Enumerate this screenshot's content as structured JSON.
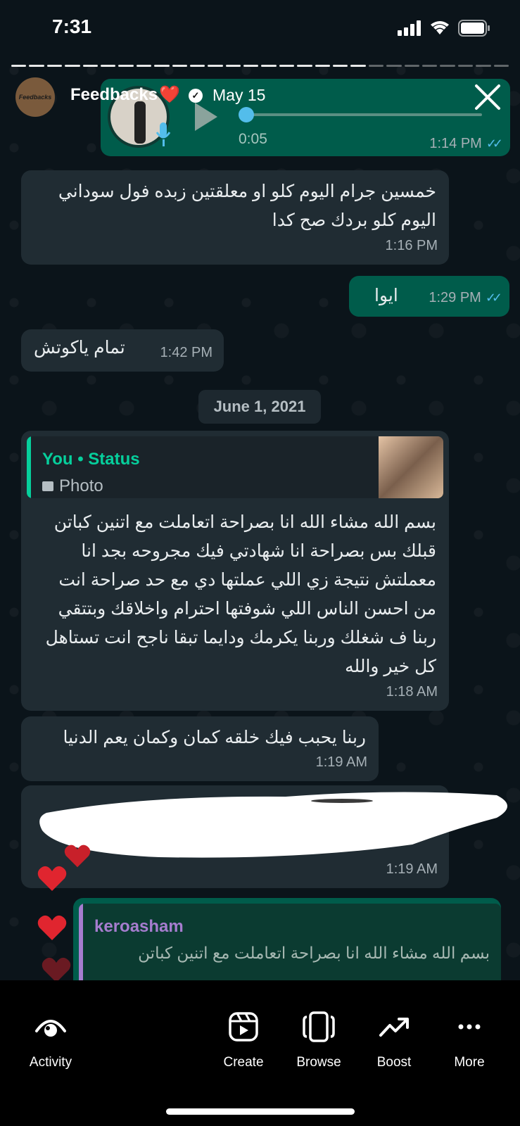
{
  "status_bar": {
    "time": "7:31"
  },
  "story": {
    "username": "Feedbacks",
    "username_emoji": "❤️",
    "avatar_text": "Feedbacks",
    "date": "May 15",
    "close_icon": "close-icon"
  },
  "voice_message": {
    "duration": "0:05",
    "time": "1:14 PM"
  },
  "messages": [
    {
      "dir": "in",
      "text": "خمسين جرام اليوم كلو او معلقتين زبده فول سوداني اليوم كلو بردك صح كدا",
      "time": "1:16 PM"
    },
    {
      "dir": "out",
      "text": "ايوا",
      "time": "1:29 PM"
    },
    {
      "dir": "in",
      "text": "تمام ياكوتش",
      "time": "1:42 PM"
    }
  ],
  "date_separator": "June 1, 2021",
  "status_reply": {
    "quote_title": "You • Status",
    "quote_sub": "Photo",
    "text": "بسم الله مشاء الله انا بصراحة اتعاملت مع اتنين كباتن قبلك بس بصراحة انا شهادتي فيك مجروحه بجد انا معملتش نتيجة زي اللي عملتها دي مع حد صراحة انت من احسن الناس اللي شوفتها احترام واخلاقك وبتتقي ربنا ف شغلك وربنا يكرمك ودايما تبقا ناجح انت تستاهل كل خير والله",
    "time": "1:18 AM"
  },
  "message_4": {
    "text": "ربنا يحبب فيك خلقه كمان وكمان يعم الدنيا",
    "time": "1:19 AM"
  },
  "message_redacted": {
    "time": "1:19 AM"
  },
  "reply_bubble": {
    "name": "keroasham",
    "text": "بسم الله مشاء الله انا بصراحة اتعاملت مع اتنين كباتن"
  },
  "bottom_nav": {
    "items": [
      {
        "label": "Activity",
        "icon": "eye-icon"
      },
      {
        "label": "Create",
        "icon": "reel-icon"
      },
      {
        "label": "Browse",
        "icon": "cards-icon"
      },
      {
        "label": "Boost",
        "icon": "trend-up-icon"
      },
      {
        "label": "More",
        "icon": "more-dots-icon"
      }
    ]
  },
  "colors": {
    "background": "#0b141a",
    "incoming_bubble": "#202c33",
    "outgoing_bubble": "#005c4b",
    "tick_blue": "#53bdeb",
    "status_green": "#06cf9c",
    "heart_red": "#e0252f"
  }
}
